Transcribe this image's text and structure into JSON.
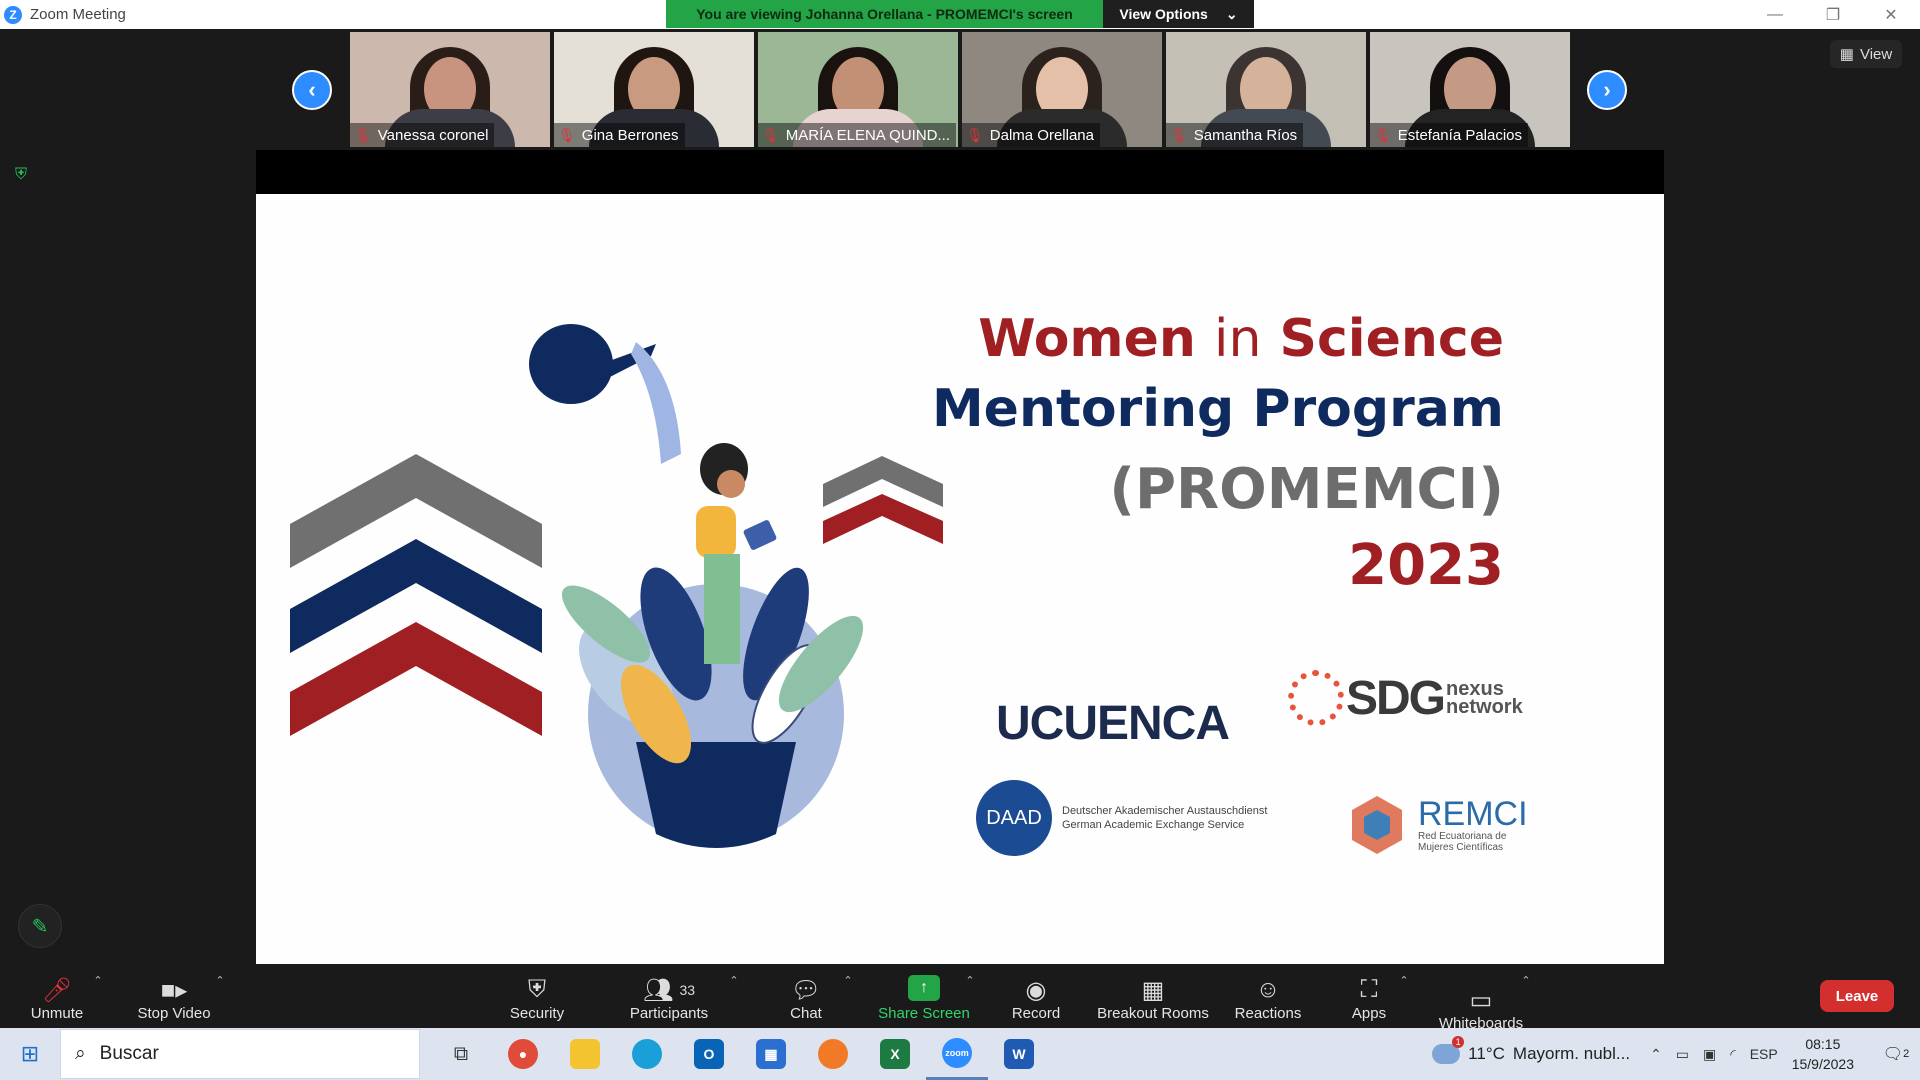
{
  "window": {
    "title": "Zoom Meeting",
    "controls": [
      "—",
      "❐",
      "✕"
    ]
  },
  "banner": {
    "viewing_text": "You are viewing Johanna Orellana - PROMEMCI's screen",
    "view_options_label": "View Options"
  },
  "gallery": {
    "view_label": "View",
    "participants": [
      {
        "name": "Vanessa coronel",
        "bg": "#cdb8ad",
        "skin": "#c89480",
        "hair": "#2a1d18",
        "shirt": "#3d3d45"
      },
      {
        "name": "Gina Berrones",
        "bg": "#e4e0d8",
        "skin": "#c89a80",
        "hair": "#1f1612",
        "shirt": "#2a2c34"
      },
      {
        "name": "MARÍA ELENA QUIND...",
        "bg": "#9bb795",
        "skin": "#c29075",
        "hair": "#1a120e",
        "shirt": "#e8d3d3"
      },
      {
        "name": "Dalma Orellana",
        "bg": "#8e8881",
        "skin": "#e4c0a8",
        "hair": "#2c221d",
        "shirt": "#2b2b2b"
      },
      {
        "name": "Samantha Ríos",
        "bg": "#c4c0b6",
        "skin": "#d5b39a",
        "hair": "#3b3433",
        "shirt": "#434a52"
      },
      {
        "name": "Estefanía Palacios",
        "bg": "#c8c4be",
        "skin": "#c49a85",
        "hair": "#151010",
        "shirt": "#232323"
      }
    ]
  },
  "slide": {
    "title_word1": "Women",
    "title_word2": "in",
    "title_word3": "Science",
    "title_line2": "Mentoring Program",
    "title_line3": "(PROMEMCI)",
    "title_line4": "2023",
    "logos": {
      "ucuenca": "UCUENCA",
      "sdg_main": "SDG",
      "sdg_sub1": "nexus",
      "sdg_sub2": "network",
      "daad": "DAAD",
      "daad_line1": "Deutscher Akademischer Austauschdienst",
      "daad_line2": "German Academic Exchange Service",
      "remci": "REMCI",
      "remci_line1": "Red Ecuatoriana de",
      "remci_line2": "Mujeres Científicas"
    }
  },
  "toolbar": {
    "unmute": "Unmute",
    "stop_video": "Stop Video",
    "security": "Security",
    "participants": "Participants",
    "participants_count": "33",
    "chat": "Chat",
    "share_screen": "Share Screen",
    "record": "Record",
    "breakout_rooms": "Breakout Rooms",
    "reactions": "Reactions",
    "apps": "Apps",
    "whiteboards": "Whiteboards",
    "leave": "Leave"
  },
  "taskbar": {
    "search_placeholder": "Buscar",
    "weather_temp": "11°C",
    "weather_desc": "Mayorm. nubl...",
    "weather_badge": "1",
    "language": "ESP",
    "time": "08:15",
    "date": "15/9/2023",
    "notifications_count": "2"
  }
}
